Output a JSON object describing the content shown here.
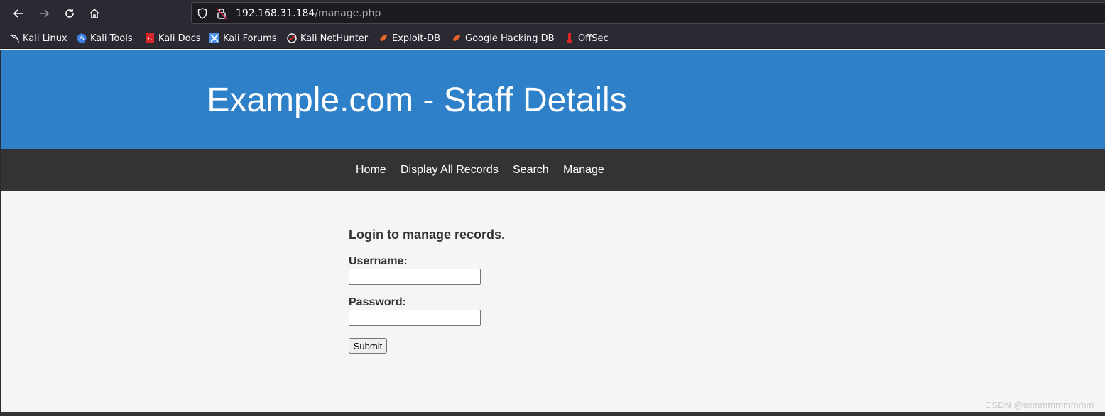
{
  "browser": {
    "url_host": "192.168.31.184",
    "url_path": "/manage.php",
    "bookmarks": [
      {
        "label": "Kali Linux",
        "icon": "kali-dragon-icon"
      },
      {
        "label": "Kali Tools",
        "icon": "kali-tools-icon"
      },
      {
        "label": "Kali Docs",
        "icon": "kali-docs-icon"
      },
      {
        "label": "Kali Forums",
        "icon": "kali-forums-icon"
      },
      {
        "label": "Kali NetHunter",
        "icon": "nethunter-icon"
      },
      {
        "label": "Exploit-DB",
        "icon": "exploitdb-icon"
      },
      {
        "label": "Google Hacking DB",
        "icon": "ghdb-icon"
      },
      {
        "label": "OffSec",
        "icon": "offsec-icon"
      }
    ]
  },
  "page": {
    "title": "Example.com - Staff Details",
    "nav": [
      "Home",
      "Display All Records",
      "Search",
      "Manage"
    ],
    "login": {
      "heading": "Login to manage records.",
      "username_label": "Username:",
      "username_value": "",
      "password_label": "Password:",
      "password_value": "",
      "submit_label": "Submit"
    }
  },
  "watermark": "CSDN @sxmmmmmmmm",
  "colors": {
    "header": "#2e81c9",
    "navbar": "#333333",
    "chrome": "#2b2a33"
  }
}
